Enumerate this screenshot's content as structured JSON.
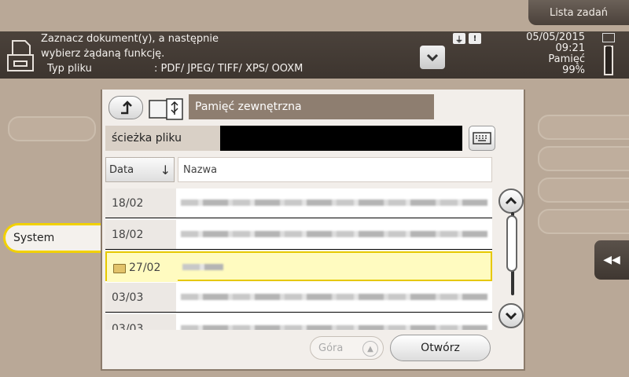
{
  "header": {
    "task_list_label": "Lista zadań"
  },
  "message": {
    "line1": "Zaznacz dokument(y), a następnie",
    "line2": "wybierz żądaną funkcję.",
    "file_type_label": "Typ pliku",
    "file_type_value": ": PDF/ JPEG/ TIFF/ XPS/ OOXM"
  },
  "status": {
    "date": "05/05/2015",
    "time": "09:21",
    "memory_label": "Pamięć",
    "memory_value": "99%",
    "memory_fraction": 0.99
  },
  "sidebar": {
    "system_tab": "System"
  },
  "browser": {
    "location": "Pamięć zewnętrzna",
    "path_label": "ścieżka pliku",
    "columns": {
      "date": "Data",
      "name": "Nazwa"
    },
    "rows": [
      {
        "date": "18/02",
        "selected": false,
        "folder": false
      },
      {
        "date": "18/02",
        "selected": false,
        "folder": false
      },
      {
        "date": "27/02",
        "selected": true,
        "folder": true
      },
      {
        "date": "03/03",
        "selected": false,
        "folder": false
      },
      {
        "date": "03/03",
        "selected": false,
        "folder": false
      }
    ],
    "top_button": "Góra",
    "open_button": "Otwórz"
  },
  "colors": {
    "background": "#b9a897",
    "selection": "#fffbc0",
    "accent": "#f2d100"
  }
}
